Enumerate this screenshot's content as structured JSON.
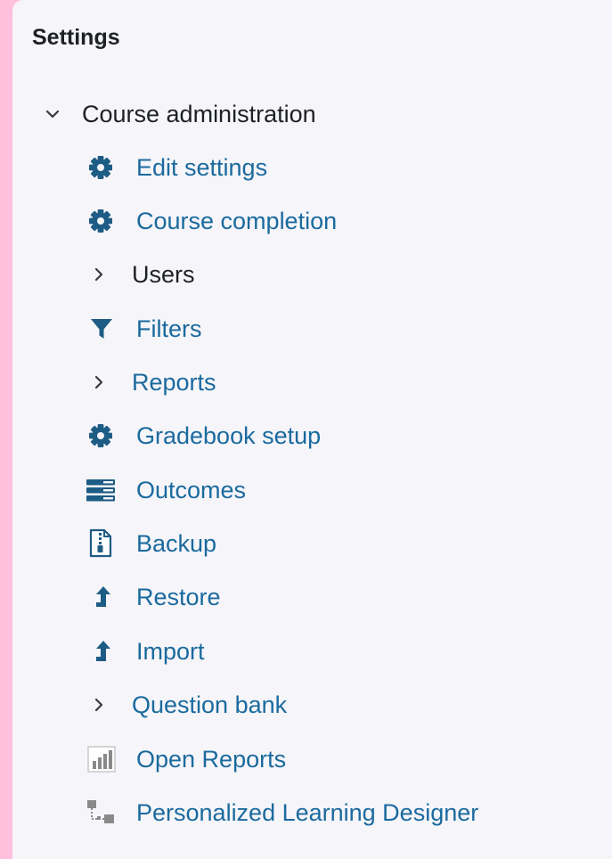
{
  "panel": {
    "title": "Settings"
  },
  "tree": {
    "root": {
      "label": "Course administration",
      "expanded": true,
      "icon": "chevron-down-icon"
    },
    "items": [
      {
        "label": "Edit settings",
        "icon": "gear-icon",
        "type": "link"
      },
      {
        "label": "Course completion",
        "icon": "gear-icon",
        "type": "link"
      },
      {
        "label": "Users",
        "icon": "chevron-right-icon",
        "type": "collapsed"
      },
      {
        "label": "Filters",
        "icon": "filter-icon",
        "type": "link"
      },
      {
        "label": "Reports",
        "icon": "chevron-right-icon",
        "type": "collapsed"
      },
      {
        "label": "Gradebook setup",
        "icon": "gear-icon",
        "type": "link"
      },
      {
        "label": "Outcomes",
        "icon": "outcomes-list-icon",
        "type": "link"
      },
      {
        "label": "Backup",
        "icon": "backup-file-icon",
        "type": "link"
      },
      {
        "label": "Restore",
        "icon": "restore-arrow-icon",
        "type": "link"
      },
      {
        "label": "Import",
        "icon": "import-arrow-icon",
        "type": "link"
      },
      {
        "label": "Question bank",
        "icon": "chevron-right-icon",
        "type": "collapsed"
      },
      {
        "label": "Open Reports",
        "icon": "bar-chart-icon",
        "type": "link"
      },
      {
        "label": "Personalized Learning Designer",
        "icon": "learning-designer-icon",
        "type": "link"
      }
    ]
  },
  "colors": {
    "background": "#ffc0de",
    "panel": "#f6f5f9",
    "link": "#1a6a9e",
    "text": "#1d2125",
    "icon": "#0f6cbf",
    "icon_dark": "#1d5c84",
    "icon_grey": "#8a8a8a"
  }
}
